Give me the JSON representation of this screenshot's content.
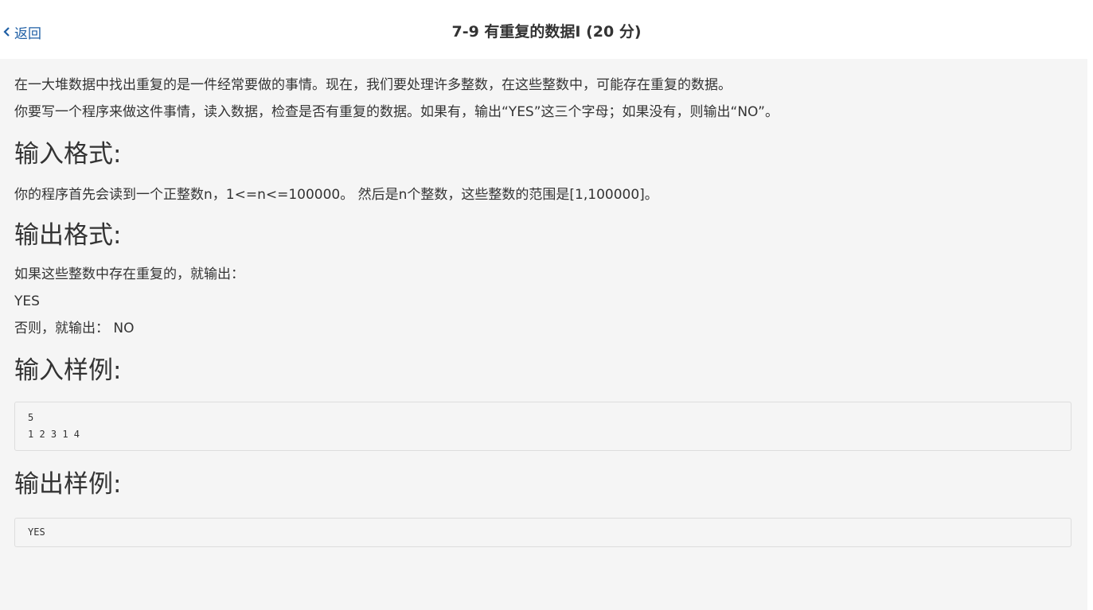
{
  "header": {
    "back_label": "返回",
    "title": "7-9 有重复的数据I (20 分)"
  },
  "problem": {
    "description": [
      "在一大堆数据中找出重复的是一件经常要做的事情。现在，我们要处理许多整数，在这些整数中，可能存在重复的数据。",
      "你要写一个程序来做这件事情，读入数据，检查是否有重复的数据。如果有，输出“YES”这三个字母；如果没有，则输出“NO”。"
    ],
    "input_heading": "输入格式:",
    "input_text": "你的程序首先会读到一个正整数n，1<=n<=100000。 然后是n个整数，这些整数的范围是[1,100000]。",
    "output_heading": "输出格式:",
    "output_lines": [
      "如果这些整数中存在重复的，就输出：",
      "YES",
      "否则，就输出： NO"
    ],
    "sample_input_heading": "输入样例:",
    "sample_input": "5\n1 2 3 1 4",
    "sample_output_heading": "输出样例:",
    "sample_output": "YES"
  }
}
